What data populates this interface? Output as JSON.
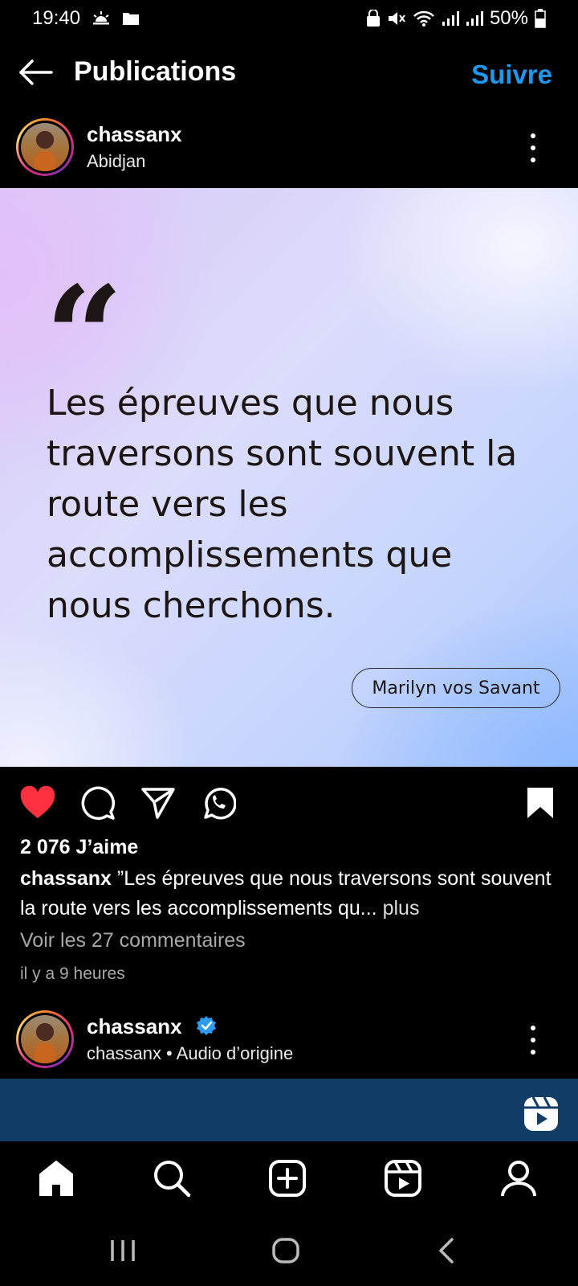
{
  "status_bar": {
    "time": "19:40",
    "battery": "50%",
    "icons": [
      "weather-icon",
      "folder-icon",
      "lock-icon",
      "mute-icon",
      "wifi-icon",
      "signal-icon",
      "signal-icon",
      "battery-icon"
    ]
  },
  "header": {
    "title": "Publications",
    "follow_label": "Suivre"
  },
  "post": {
    "username": "chassanx",
    "location": "Abidjan",
    "quote_mark": "“",
    "quote_text": "Les épreuves que nous traversons sont souvent la route vers les accomplissements que nous cherchons.",
    "quote_author": "Marilyn vos Savant",
    "likes": "2 076 J’aime",
    "caption_user": "chassanx",
    "caption_text": "”Les épreuves que nous traversons sont souvent la route vers les accomplissements qu...",
    "caption_more": "plus",
    "comments_link": "Voir les 27 commentaires",
    "time_ago": "il y a 9 heures",
    "liked": true,
    "saved": true
  },
  "next_post": {
    "username": "chassanx",
    "audio": "chassanx • Audio d’origine",
    "verified": true
  },
  "colors": {
    "accent": "#1f96f0",
    "like": "#ff3040",
    "video_bg": "#103c66"
  },
  "bottom_nav": [
    "home-icon",
    "search-icon",
    "create-icon",
    "reels-icon",
    "profile-icon"
  ]
}
